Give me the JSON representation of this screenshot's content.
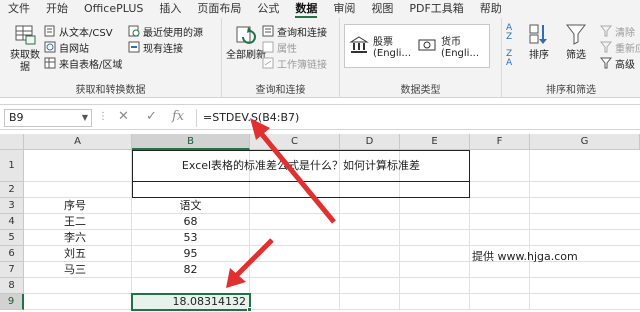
{
  "tabs": [
    "文件",
    "开始",
    "OfficePLUS",
    "插入",
    "页面布局",
    "公式",
    "数据",
    "审阅",
    "视图",
    "PDF工具箱",
    "帮助"
  ],
  "active_tab": "数据",
  "ribbon": {
    "get_data": {
      "big_label": "获取数据",
      "items": [
        "从文本/CSV",
        "自网站",
        "来自表格/区域",
        "最近使用的源",
        "现有连接"
      ],
      "group_label": "获取和转换数据"
    },
    "queries": {
      "big_label": "全部刷新",
      "items": [
        "查询和连接",
        "属性",
        "工作簿链接"
      ],
      "group_label": "查询和连接"
    },
    "data_types": {
      "stocks": "股票 (Engli...",
      "currency": "货币 (Engli...",
      "group_label": "数据类型"
    },
    "sort_filter": {
      "sort": "排序",
      "filter": "筛选",
      "clear": "清除",
      "reapply": "重新应用",
      "advanced": "高级",
      "group_label": "排序和筛选"
    }
  },
  "formula_bar": {
    "name_box": "B9",
    "formula": "=STDEV.S(B4:B7)"
  },
  "columns": [
    "A",
    "B",
    "C",
    "D",
    "E",
    "F",
    "G"
  ],
  "rows": [
    "1",
    "2",
    "3",
    "4",
    "5",
    "6",
    "7",
    "8",
    "9"
  ],
  "sheet": {
    "title": "Excel表格的标准差公式是什么？如何计算标准差",
    "header_a": "序号",
    "header_b": "语文",
    "names": [
      "王二",
      "李六",
      "刘五",
      "马三"
    ],
    "scores": [
      "68",
      "53",
      "95",
      "82"
    ],
    "result": "18.08314132",
    "credit": "提供 www.hjga.com"
  },
  "colors": {
    "accent": "#217346",
    "arrow": "#e03030"
  }
}
